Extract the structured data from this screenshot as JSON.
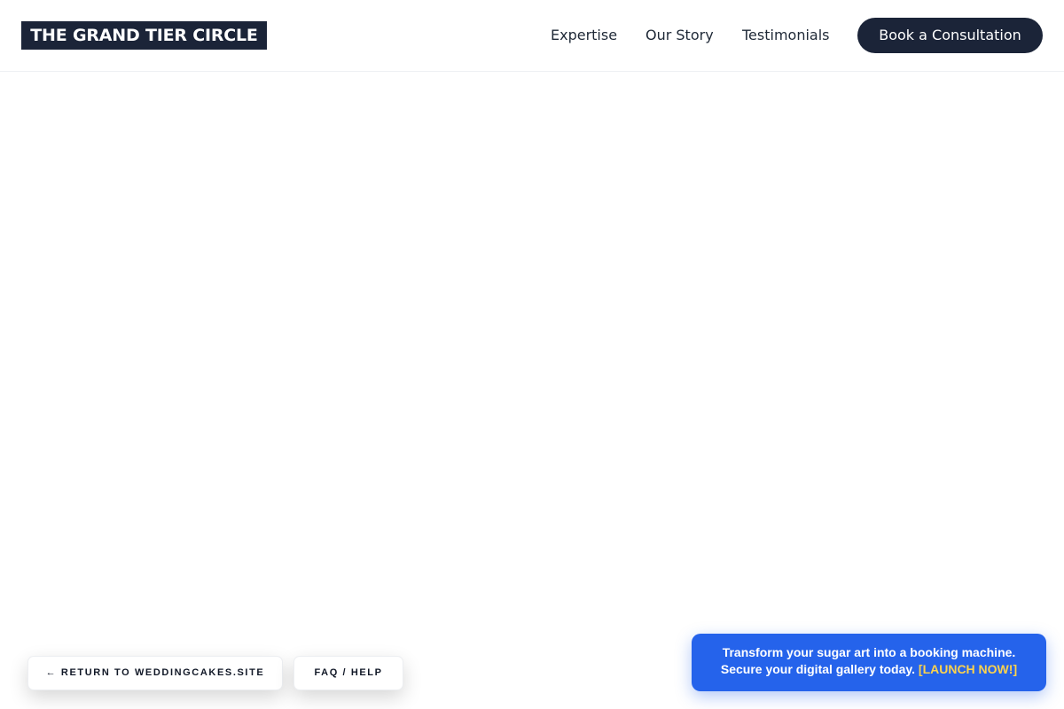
{
  "header": {
    "logo": "THE GRAND TIER CIRCLE",
    "nav": [
      "Expertise",
      "Our Story",
      "Testimonials"
    ],
    "cta_label": "Book a Consultation"
  },
  "footer_pills": {
    "return_label": "← RETURN TO WEDDINGCAKES.SITE",
    "faq_label": "FAQ / HELP"
  },
  "promo": {
    "line1": "Transform your sugar art into a booking machine.",
    "line2": "Secure your digital gallery today.",
    "link": "[LAUNCH NOW!]"
  },
  "colors": {
    "navy": "#1b2438",
    "promo_blue": "#2563eb",
    "promo_link": "#fcd34d"
  }
}
